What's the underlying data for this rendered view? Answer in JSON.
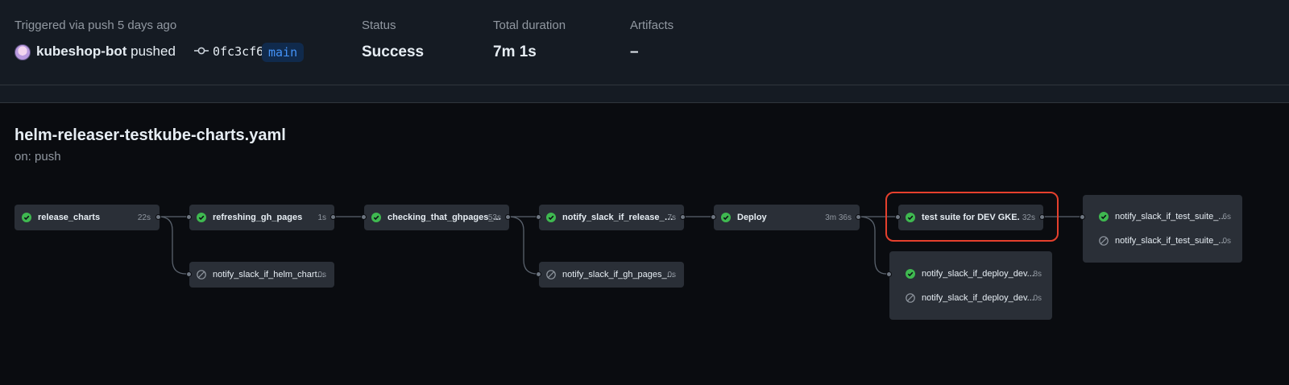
{
  "run": {
    "triggered_label": "Triggered via push 5 days ago",
    "actor": "kubeshop-bot",
    "action": "pushed",
    "commit_sha": "0fc3cf6",
    "branch": "main",
    "status_label": "Status",
    "status_value": "Success",
    "duration_label": "Total duration",
    "duration_value": "7m 1s",
    "artifacts_label": "Artifacts",
    "artifacts_value": "–"
  },
  "workflow": {
    "file": "helm-releaser-testkube-charts.yaml",
    "trigger": "on: push"
  },
  "colors": {
    "success": "#3fb950",
    "skipped": "#9198a1",
    "highlight": "#e5402d"
  },
  "jobs": {
    "release_charts": {
      "name": "release_charts",
      "duration": "22s",
      "status": "success"
    },
    "refreshing_gh_pages": {
      "name": "refreshing_gh_pages",
      "duration": "1s",
      "status": "success"
    },
    "notify_helm": {
      "name": "notify_slack_if_helm_chart...",
      "duration": "0s",
      "status": "skipped"
    },
    "checking_ghpages": {
      "name": "checking_that_ghpages_...",
      "duration": "53s",
      "status": "success"
    },
    "notify_release": {
      "name": "notify_slack_if_release_su...",
      "duration": "7s",
      "status": "success"
    },
    "notify_gh_pages": {
      "name": "notify_slack_if_gh_pages_...",
      "duration": "0s",
      "status": "skipped"
    },
    "deploy": {
      "name": "Deploy",
      "duration": "3m 36s",
      "status": "success"
    },
    "test_suite": {
      "name": "test suite for DEV GKE.",
      "duration": "32s",
      "status": "success"
    },
    "notify_deploy_1": {
      "name": "notify_slack_if_deploy_dev...",
      "duration": "8s",
      "status": "success"
    },
    "notify_deploy_2": {
      "name": "notify_slack_if_deploy_dev...",
      "duration": "0s",
      "status": "skipped"
    },
    "notify_test_1": {
      "name": "notify_slack_if_test_suite_...",
      "duration": "6s",
      "status": "success"
    },
    "notify_test_2": {
      "name": "notify_slack_if_test_suite_...",
      "duration": "0s",
      "status": "skipped"
    }
  }
}
